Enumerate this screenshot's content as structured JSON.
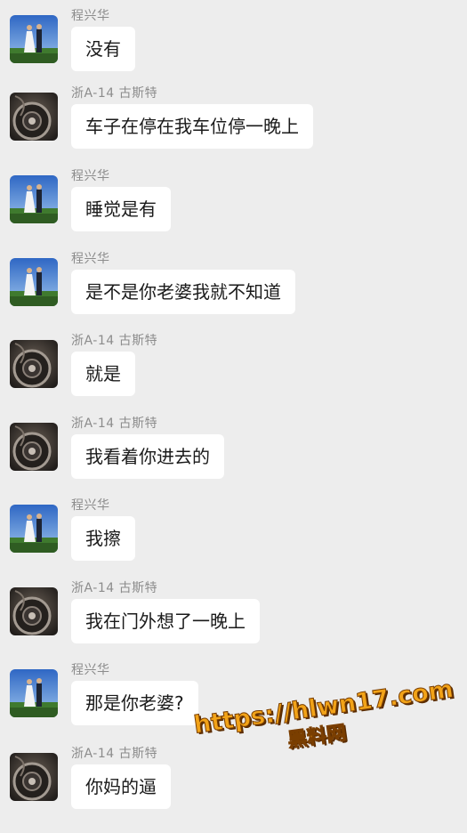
{
  "messages": [
    {
      "sender": "程兴华",
      "text": "没有",
      "avatar": "avatar-couple"
    },
    {
      "sender": "浙A-14 古斯特",
      "text": "车子在停在我车位停一晚上",
      "avatar": "avatar-wheel"
    },
    {
      "sender": "程兴华",
      "text": "睡觉是有",
      "avatar": "avatar-couple"
    },
    {
      "sender": "程兴华",
      "text": "是不是你老婆我就不知道",
      "avatar": "avatar-couple"
    },
    {
      "sender": "浙A-14 古斯特",
      "text": "就是",
      "avatar": "avatar-wheel"
    },
    {
      "sender": "浙A-14 古斯特",
      "text": "我看着你进去的",
      "avatar": "avatar-wheel"
    },
    {
      "sender": "程兴华",
      "text": "我擦",
      "avatar": "avatar-couple"
    },
    {
      "sender": "浙A-14 古斯特",
      "text": "我在门外想了一晚上",
      "avatar": "avatar-wheel"
    },
    {
      "sender": "程兴华",
      "text": "那是你老婆?",
      "avatar": "avatar-couple"
    },
    {
      "sender": "浙A-14 古斯特",
      "text": "你妈的逼",
      "avatar": "avatar-wheel"
    }
  ],
  "watermark": {
    "url": "https://hlwn17.com",
    "subtitle": "黑料网"
  },
  "colors": {
    "background": "#ededed",
    "bubble": "#ffffff",
    "sender_name": "#8c8c8c",
    "watermark": "#f2a318"
  }
}
